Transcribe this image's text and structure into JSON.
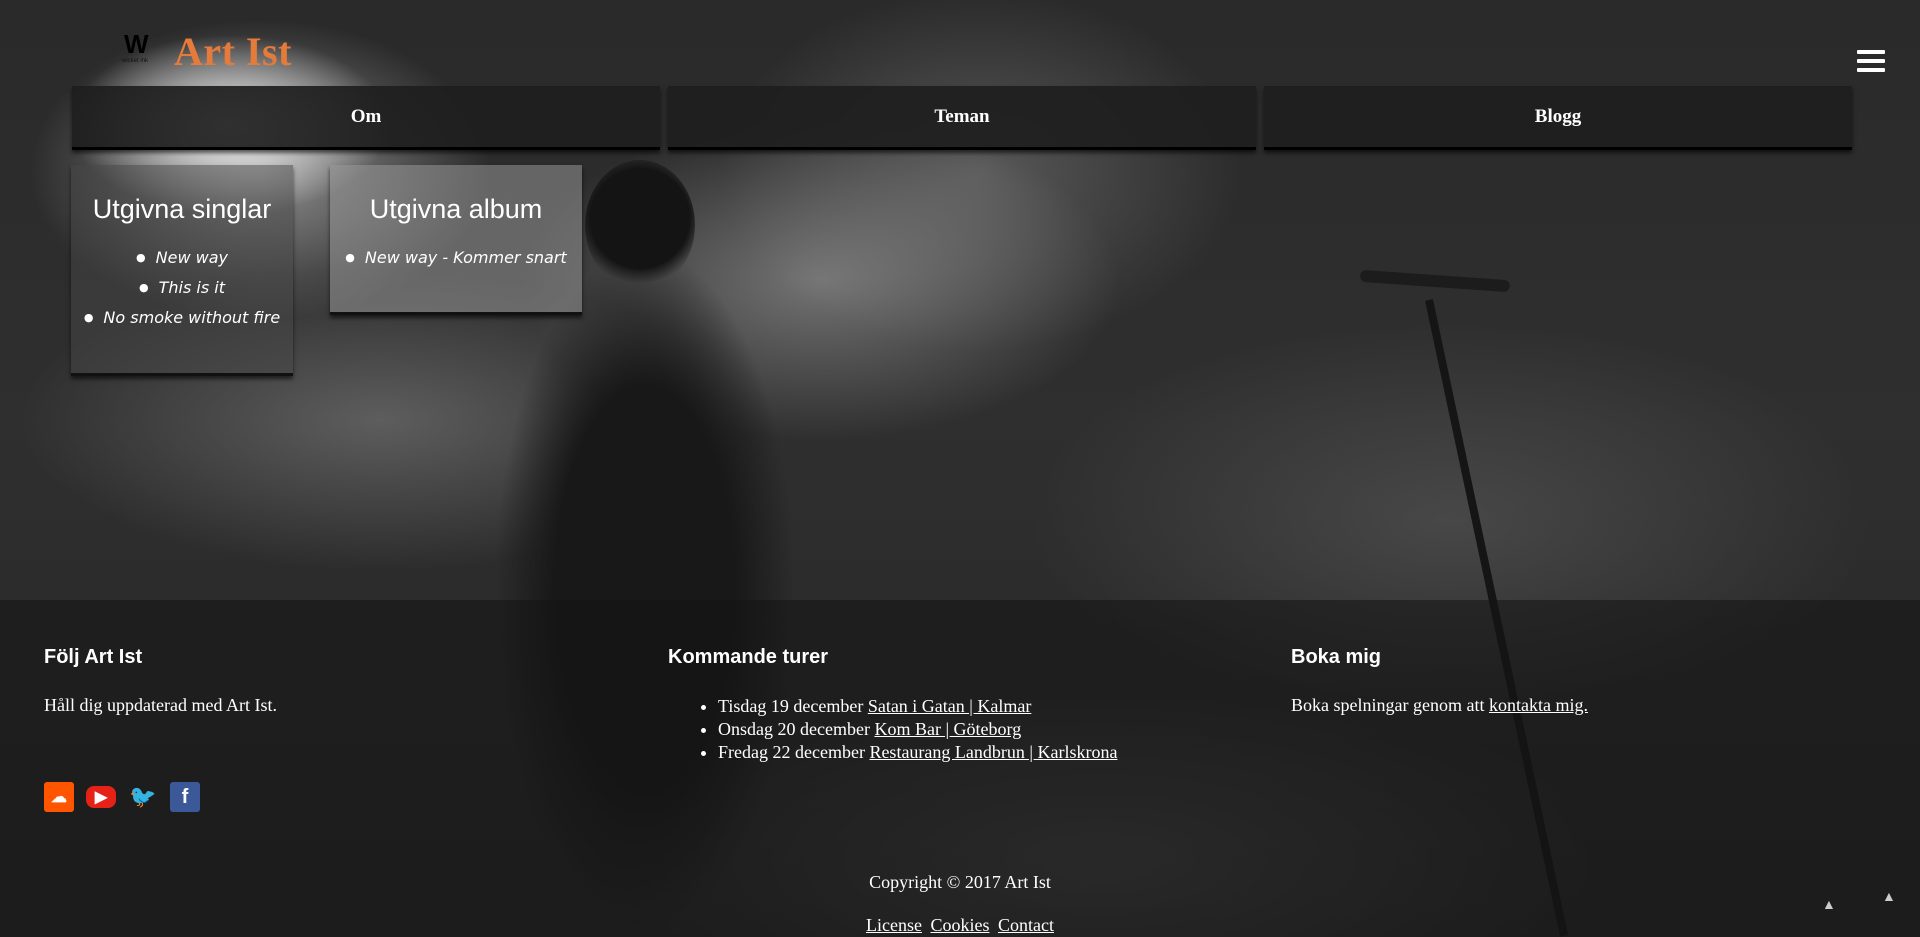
{
  "header": {
    "logo_letter": "W",
    "logo_subtext": "wicket ink",
    "title": "Art Ist"
  },
  "nav": {
    "items": [
      {
        "label": "Om"
      },
      {
        "label": "Teman"
      },
      {
        "label": "Blogg"
      }
    ]
  },
  "singles": {
    "title": "Utgivna singlar",
    "items": [
      "New way",
      "This is it",
      "No smoke without fire"
    ]
  },
  "albums": {
    "title": "Utgivna album",
    "items": [
      "New way - Kommer snart"
    ]
  },
  "footer": {
    "follow": {
      "heading": "Följ Art Ist",
      "text": "Håll dig uppdaterad med Art Ist.",
      "social_icons": [
        "soundcloud-icon",
        "youtube-icon",
        "twitter-icon",
        "facebook-icon"
      ]
    },
    "tours": {
      "heading": "Kommande turer",
      "items": [
        {
          "date": "Tisdag 19 december",
          "venue": "Satan i Gatan | Kalmar"
        },
        {
          "date": "Onsdag 20 december",
          "venue": "Kom Bar | Göteborg"
        },
        {
          "date": "Fredag 22 december",
          "venue": "Restaurang Landbrun | Karlskrona"
        }
      ]
    },
    "booking": {
      "heading": "Boka mig",
      "text": "Boka spelningar genom att",
      "link": "kontakta mig."
    },
    "copyright": "Copyright © 2017 Art Ist",
    "links": [
      "License",
      "Cookies",
      "Contact"
    ]
  },
  "colors": {
    "accent": "#e57b3a",
    "background": "#2b2b2b"
  }
}
